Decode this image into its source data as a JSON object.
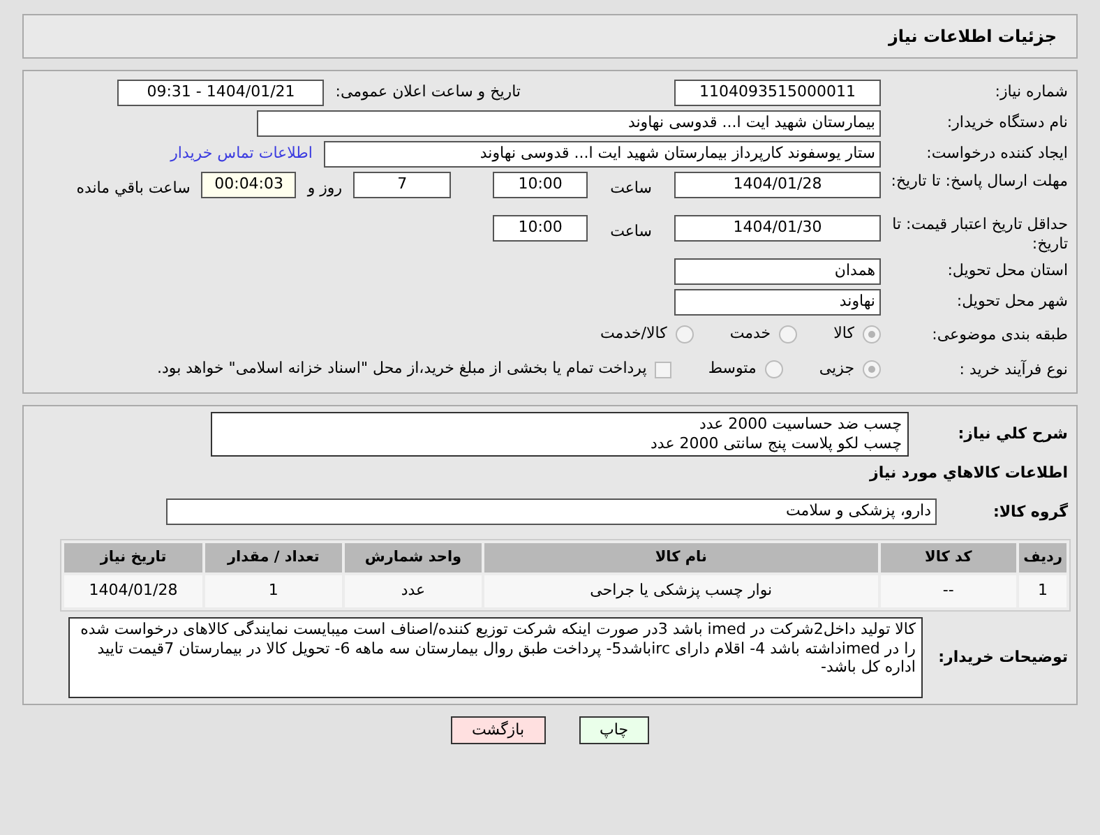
{
  "page_title": "جزئیات اطلاعات نیاز",
  "need_number": {
    "label": "شماره نیاز:",
    "value": "1104093515000011"
  },
  "announce": {
    "label": "تاریخ و ساعت اعلان عمومی:",
    "value": "1404/01/21 - 09:31"
  },
  "buyer_org": {
    "label": "نام دستگاه خریدار:",
    "value": "بیمارستان شهید ایت ا... قدوسی نهاوند"
  },
  "creator": {
    "label": "ایجاد کننده درخواست:",
    "value": "ستار یوسفوند کارپرداز بیمارستان شهید ایت ا... قدوسی نهاوند",
    "link": "اطلاعات تماس خریدار"
  },
  "deadline": {
    "label": "مهلت ارسال پاسخ: تا تاریخ:",
    "date": "1404/01/28",
    "time_label": "ساعت",
    "time": "10:00",
    "days": "7",
    "days_label": "روز و",
    "remaining": "00:04:03",
    "remaining_label": "ساعت باقي مانده"
  },
  "validity": {
    "label": "حداقل تاریخ اعتبار قیمت: تا تاریخ:",
    "date": "1404/01/30",
    "time_label": "ساعت",
    "time": "10:00"
  },
  "province": {
    "label": "استان محل تحویل:",
    "value": "همدان"
  },
  "city": {
    "label": "شهر محل تحویل:",
    "value": "نهاوند"
  },
  "category": {
    "label": "طبقه بندی موضوعی:",
    "options": [
      {
        "label": "کالا",
        "selected": true
      },
      {
        "label": "خدمت",
        "selected": false
      },
      {
        "label": "کالا/خدمت",
        "selected": false
      }
    ]
  },
  "purchase_type": {
    "label": "نوع فرآیند خرید :",
    "options": [
      {
        "label": "جزیی",
        "selected": true
      },
      {
        "label": "متوسط",
        "selected": false
      }
    ],
    "payment": {
      "label": "پرداخت تمام یا بخشی از مبلغ خرید،از محل \"اسناد خزانه اسلامی\" خواهد بود.",
      "checked": false
    }
  },
  "description": {
    "label": "شرح کلي نیاز:",
    "lines": [
      "چسب ضد حساسیت 2000 عدد",
      "چسب لکو پلاست پنج سانتی 2000 عدد"
    ]
  },
  "goods_heading": "اطلاعات کالاهاي مورد نیاز",
  "goods_group": {
    "label": "گروه کالا:",
    "value": "دارو، پزشکی و سلامت"
  },
  "table": {
    "columns": [
      "ردیف",
      "کد کالا",
      "نام کالا",
      "واحد شمارش",
      "تعداد / مقدار",
      "تاریخ نیاز"
    ],
    "rows": [
      [
        "1",
        "--",
        "نوار چسب پزشکی یا جراحی",
        "عدد",
        "1",
        "1404/01/28"
      ]
    ]
  },
  "buyer_notes": {
    "label": "توضیحات خریدار:",
    "value": "کالا تولید داخل2شرکت در imed باشد 3در صورت اینکه شرکت توزیع کننده/اصناف است میبایست نمایندگی کالاهای درخواست شده را  در imedداشته باشد 4- اقلام دارای ircباشد5- پرداخت طبق روال بیمارستان سه ماهه 6- تحویل کالا در بیمارستان 7قیمت تایید اداره کل باشد-"
  },
  "buttons": [
    {
      "label": "چاپ",
      "kind": "print"
    },
    {
      "label": "بازگشت",
      "kind": "back"
    }
  ]
}
